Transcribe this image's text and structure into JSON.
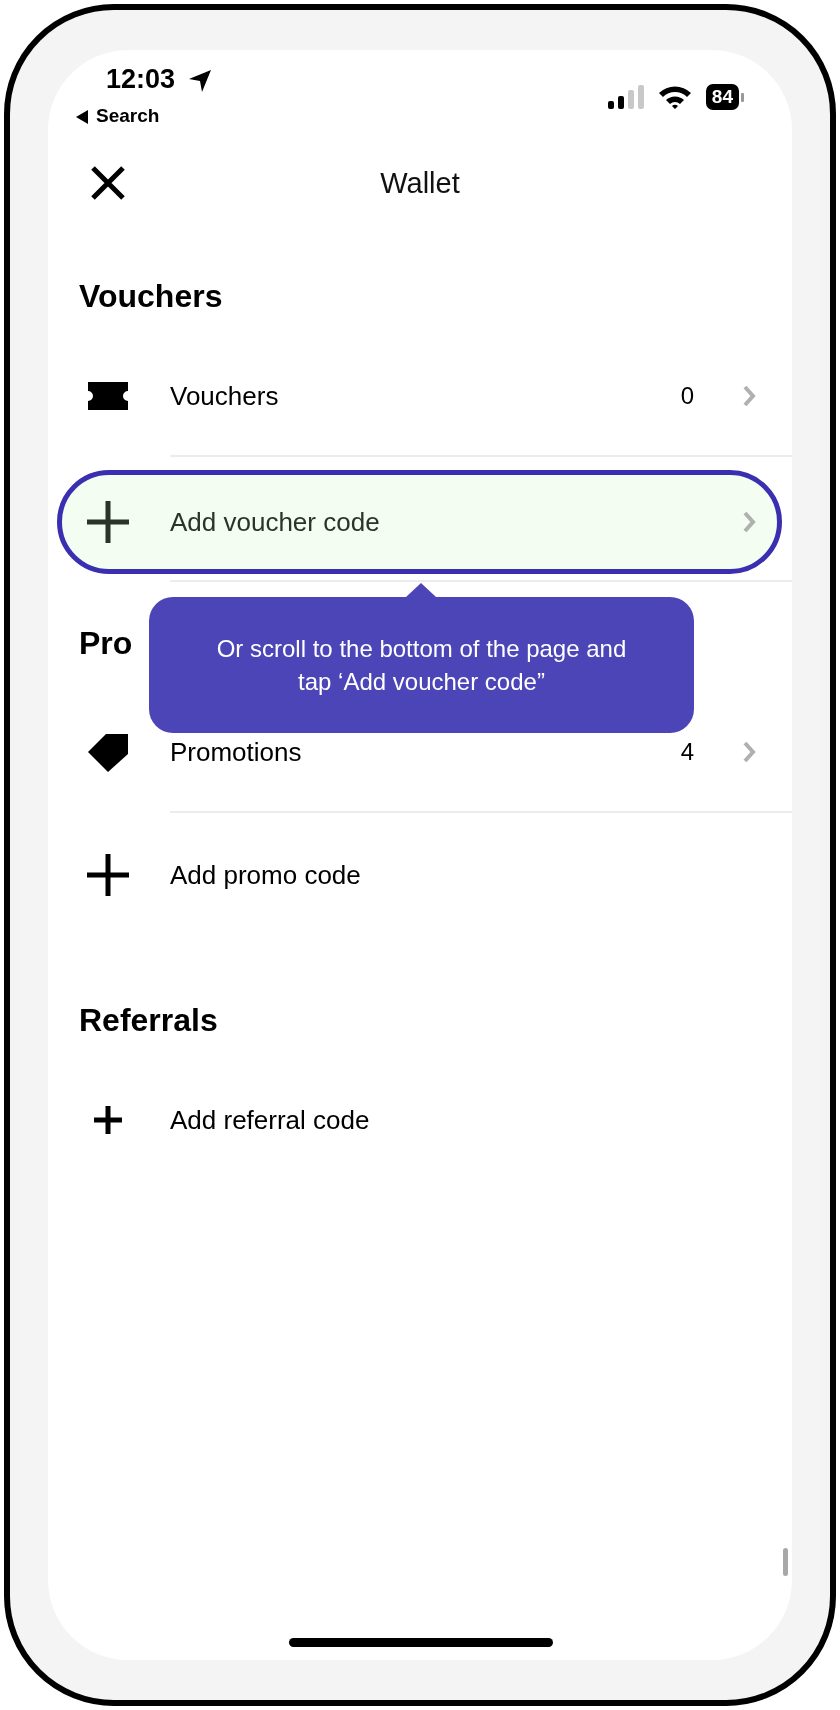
{
  "status_bar": {
    "time": "12:03",
    "back_label": "Search",
    "battery": "84"
  },
  "header": {
    "title": "Wallet"
  },
  "sections": [
    {
      "heading": "Vouchers",
      "rows": [
        {
          "kind": "link",
          "label": "Vouchers",
          "count": "0",
          "highlighted": false
        },
        {
          "kind": "add",
          "label": "Add voucher code",
          "highlighted": true
        }
      ]
    },
    {
      "heading": "Pro",
      "rows": [
        {
          "kind": "link",
          "label": "Promotions",
          "count": "4",
          "highlighted": false
        },
        {
          "kind": "add",
          "label": "Add promo code",
          "highlighted": false
        }
      ]
    },
    {
      "heading": "Referrals",
      "rows": [
        {
          "kind": "add",
          "label": "Add referral code",
          "highlighted": false
        }
      ]
    }
  ],
  "tooltip": {
    "text": "Or scroll to the bottom of the page and tap ‘Add voucher code”"
  }
}
